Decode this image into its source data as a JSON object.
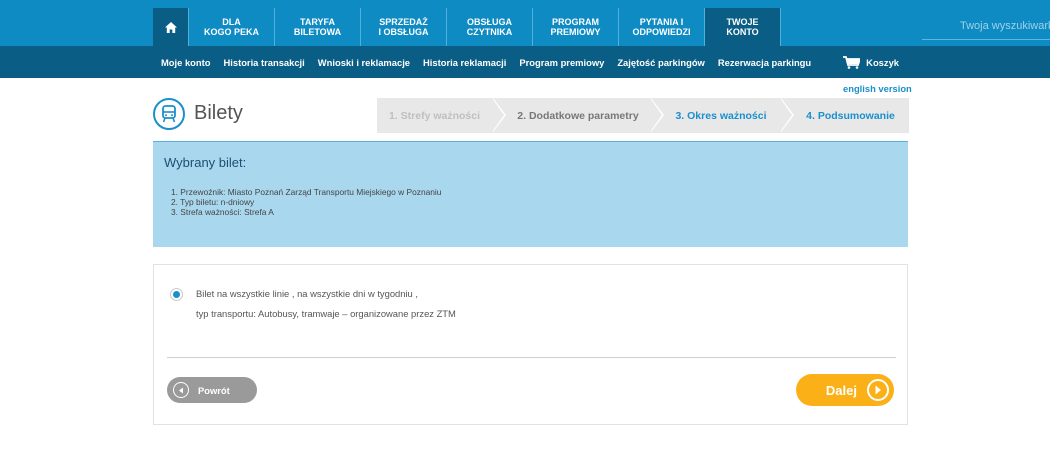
{
  "nav": {
    "home_icon": "home-icon",
    "items": [
      {
        "line1": "DLA",
        "line2": "KOGO PEKA"
      },
      {
        "line1": "TARYFA",
        "line2": "BILETOWA"
      },
      {
        "line1": "SPRZEDAŻ",
        "line2": "I OBSŁUGA"
      },
      {
        "line1": "OBSŁUGA",
        "line2": "CZYTNIKA"
      },
      {
        "line1": "PROGRAM",
        "line2": "PREMIOWY"
      },
      {
        "line1": "PYTANIA I",
        "line2": "ODPOWIEDZI"
      },
      {
        "line1": "TWOJE",
        "line2": "KONTO"
      }
    ],
    "search_placeholder": "Twoja wyszukiwarka"
  },
  "subnav": {
    "items": [
      "Moje konto",
      "Historia transakcji",
      "Wnioski i reklamacje",
      "Historia reklamacji",
      "Program premiowy",
      "Zajętość parkingów",
      "Rezerwacja parkingu"
    ],
    "cart_label": "Koszyk"
  },
  "english_link": "english version",
  "page_title": "Bilety",
  "steps": [
    "1. Strefy ważności",
    "2. Dodatkowe parametry",
    "3. Okres ważności",
    "4. Podsumowanie"
  ],
  "selected": {
    "heading": "Wybrany bilet:",
    "lines": [
      "1. Przewoźnik: Miasto Poznań Zarząd Transportu Miejskiego w Poznaniu",
      "2. Typ biletu: n-dniowy",
      "3. Strefa ważności: Strefa A"
    ]
  },
  "option": {
    "line1": "Bilet na wszystkie linie , na wszystkie dni w tygodniu ,",
    "line2": "typ transportu: Autobusy, tramwaje – organizowane przez ZTM",
    "selected": true
  },
  "buttons": {
    "back": "Powrót",
    "next": "Dalej"
  },
  "colors": {
    "nav_blue": "#0f8bc4",
    "nav_dark": "#0a5d85",
    "accent": "#1a8fcb",
    "panel": "#a9d8ee",
    "next_orange": "#fbb017"
  }
}
